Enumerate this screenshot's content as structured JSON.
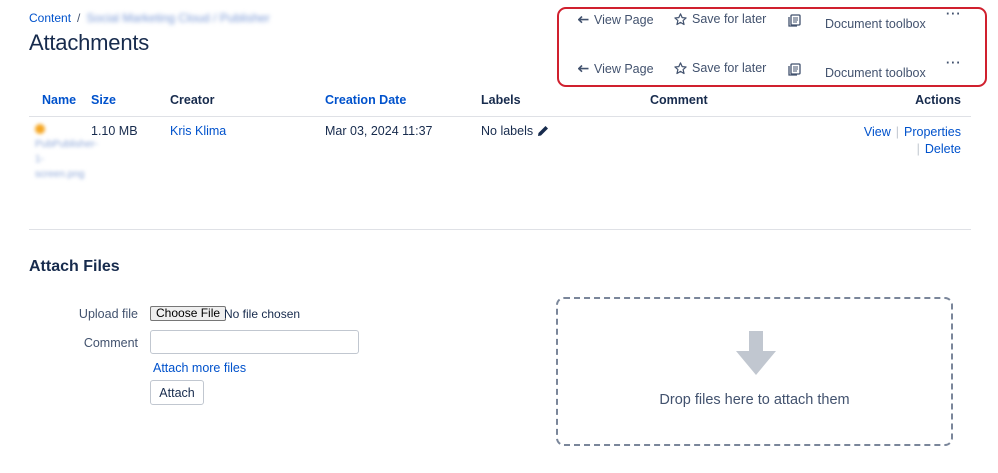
{
  "breadcrumb": {
    "root": "Content",
    "separator": "/",
    "current_blurred": "Social Marketing Cloud / Publisher"
  },
  "page_title": "Attachments",
  "toolbar": {
    "view_page": "View Page",
    "save_for_later": "Save for later",
    "document_toolbox": "Document toolbox",
    "more": "···"
  },
  "table": {
    "columns": {
      "name": "Name",
      "size": "Size",
      "creator": "Creator",
      "creation_date": "Creation Date",
      "labels": "Labels",
      "comment": "Comment",
      "actions": "Actions"
    },
    "rows": [
      {
        "name_blurred": "PubPublisher-1-screen.png",
        "size": "1.10 MB",
        "creator": "Kris Klima",
        "creation_date": "Mar 03, 2024 11:37",
        "labels": "No labels",
        "action_view": "View",
        "action_properties": "Properties",
        "action_delete": "Delete"
      }
    ]
  },
  "attach_files": {
    "title": "Attach Files",
    "upload_label": "Upload file",
    "choose_file": "Choose File",
    "no_file": "No file chosen",
    "comment_label": "Comment",
    "attach_more": "Attach more files",
    "attach_button": "Attach",
    "drop_text": "Drop files here to attach them"
  },
  "colors": {
    "link": "#0052cc",
    "highlight_border": "#d0202e",
    "text": "#172b4d",
    "muted": "#42526e"
  }
}
